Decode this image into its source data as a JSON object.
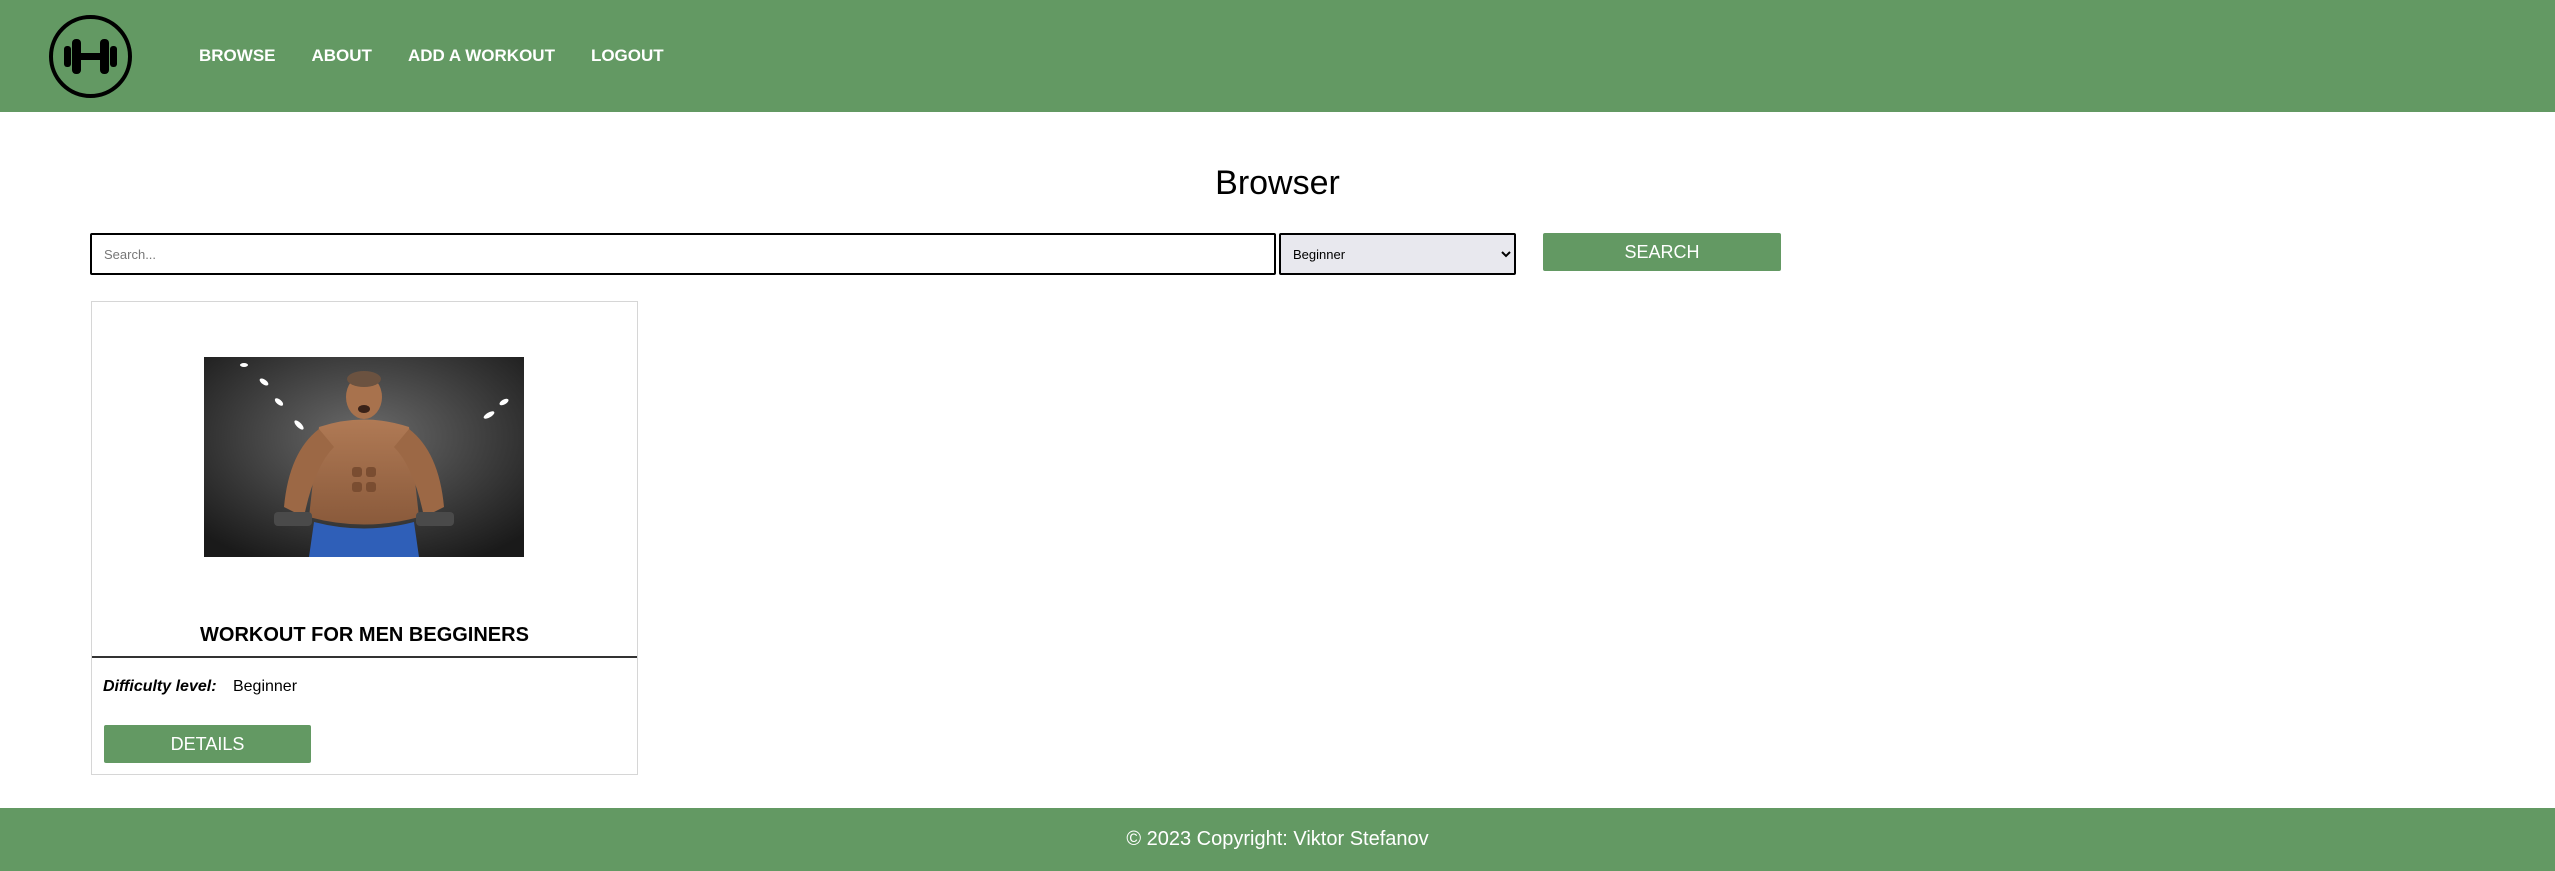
{
  "header": {
    "logo_icon": "dumbbell-icon",
    "nav": [
      {
        "label": "BROWSE"
      },
      {
        "label": "ABOUT"
      },
      {
        "label": "ADD A WORKOUT"
      },
      {
        "label": "LOGOUT"
      }
    ]
  },
  "main": {
    "title": "Browser",
    "search": {
      "placeholder": "Search...",
      "value": "",
      "difficulty_selected": "Beginner",
      "button_label": "SEARCH"
    },
    "cards": [
      {
        "image_icon": "workout-photo",
        "title": "WORKOUT FOR MEN BEGGINERS",
        "difficulty_label": "Difficulty level:",
        "difficulty_value": "Beginner",
        "button_label": "DETAILS"
      }
    ]
  },
  "footer": {
    "text": "© 2023 Copyright: Viktor Stefanov"
  },
  "colors": {
    "brand_green": "#639963",
    "white": "#ffffff",
    "black": "#000000"
  }
}
